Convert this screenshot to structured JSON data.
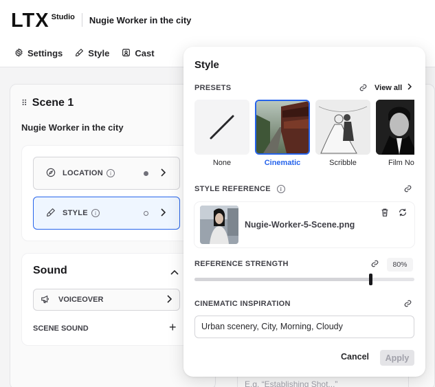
{
  "app": {
    "logo_text": "LTX",
    "logo_sub": "Studio",
    "project_title": "Nugie Worker in the city"
  },
  "tabs": [
    {
      "label": "Settings",
      "icon": "gear-icon"
    },
    {
      "label": "Style",
      "icon": "brush-icon"
    },
    {
      "label": "Cast",
      "icon": "person-card-icon"
    }
  ],
  "scene": {
    "drag": "⠿",
    "title": "Scene 1",
    "subtitle": "Nugie Worker in the city",
    "more": "⋮",
    "location_label": "LOCATION",
    "style_label": "STYLE",
    "sound": {
      "title": "Sound",
      "voiceover_label": "VOICEOVER",
      "scene_sound_label": "SCENE SOUND",
      "add": "+"
    }
  },
  "background": {
    "placeholder": "E.g. “Establishing Shot...”"
  },
  "style_popover": {
    "title": "Style",
    "presets_label": "PRESETS",
    "view_all": "View all",
    "presets": [
      {
        "name": "None"
      },
      {
        "name": "Cinematic",
        "selected": true
      },
      {
        "name": "Scribble"
      },
      {
        "name": "Film Noir"
      }
    ],
    "style_reference_label": "STYLE REFERENCE",
    "reference_file": "Nugie-Worker-5-Scene.png",
    "reference_strength_label": "REFERENCE STRENGTH",
    "reference_strength_value": "80%",
    "reference_strength_fraction": 0.8,
    "cinematic_inspiration_label": "CINEMATIC INSPIRATION",
    "cinematic_inspiration_value": "Urban scenery, City, Morning, Cloudy",
    "cancel_label": "Cancel",
    "apply_label": "Apply"
  },
  "colors": {
    "accent": "#2563eb",
    "active_bg": "#eff6ff",
    "text": "#18181b"
  }
}
